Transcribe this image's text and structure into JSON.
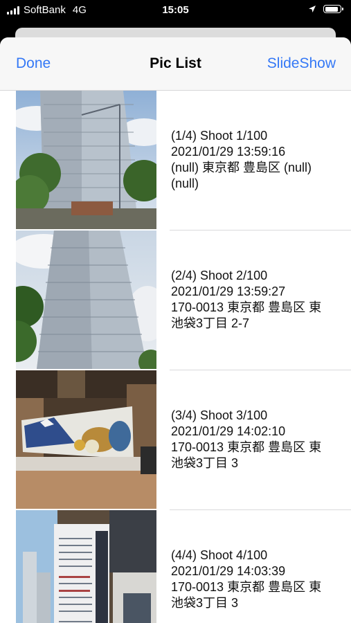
{
  "status_bar": {
    "carrier": "SoftBank",
    "network": "4G",
    "time": "15:05"
  },
  "nav": {
    "done_label": "Done",
    "title": "Pic List",
    "slideshow_label": "SlideShow"
  },
  "items": [
    {
      "line1": "(1/4) Shoot 1/100",
      "line2": "2021/01/29 13:59:16",
      "line3": "(null) 東京都 豊島区 (null)",
      "line4": "(null)"
    },
    {
      "line1": "(2/4) Shoot 2/100",
      "line2": "2021/01/29 13:59:27",
      "line3": "170-0013 東京都 豊島区 東",
      "line4": "池袋3丁目 2-7"
    },
    {
      "line1": "(3/4) Shoot 3/100",
      "line2": "2021/01/29 14:02:10",
      "line3": "170-0013 東京都 豊島区 東",
      "line4": "池袋3丁目 3"
    },
    {
      "line1": "(4/4) Shoot 4/100",
      "line2": "2021/01/29 14:03:39",
      "line3": "170-0013 東京都 豊島区 東",
      "line4": "池袋3丁目 3"
    }
  ]
}
